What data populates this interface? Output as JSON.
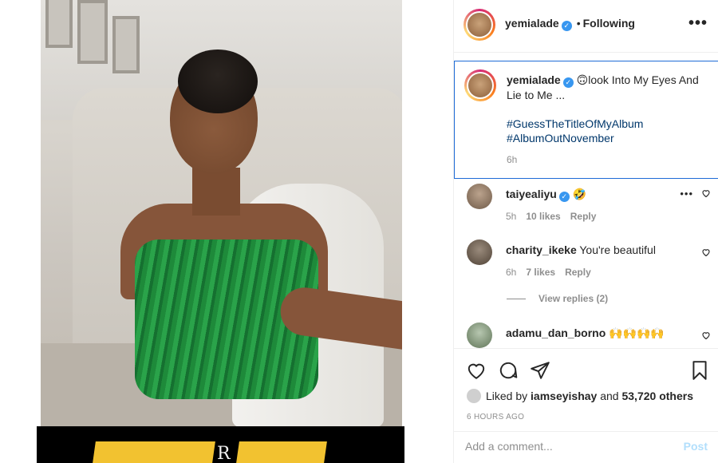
{
  "header": {
    "username": "yemialade",
    "dot": "•",
    "follow_status": "Following",
    "more": "•••"
  },
  "caption": {
    "username": "yemialade",
    "emoji": "🙃",
    "text": "look Into My Eyes And Lie to Me ...",
    "hashtags": [
      "#GuessTheTitleOfMyAlbum",
      "#AlbumOutNovember"
    ],
    "time": "6h"
  },
  "comments": [
    {
      "username": "taiyealiyu",
      "verified": true,
      "text": "🤣",
      "time": "5h",
      "likes": "10 likes",
      "reply": "Reply"
    },
    {
      "username": "charity_ikeke",
      "verified": false,
      "text": "You're beautiful",
      "time": "6h",
      "likes": "7 likes",
      "reply": "Reply"
    },
    {
      "username": "adamu_dan_borno",
      "verified": false,
      "text": "🙌🙌🙌🙌"
    }
  ],
  "view_replies": "View replies (2)",
  "likes": {
    "prefix": "Liked by",
    "user": "iamseyishay",
    "and": "and",
    "others": "53,720 others"
  },
  "post_time": "6 HOURS AGO",
  "add_comment": {
    "placeholder": "Add a comment...",
    "post_label": "Post"
  },
  "banner": {
    "text": "R"
  },
  "colors": {
    "link_blue": "#00376b",
    "verified_blue": "#3897f0",
    "focus_border": "#1e6bd6",
    "post_disabled": "#b2dffc"
  }
}
